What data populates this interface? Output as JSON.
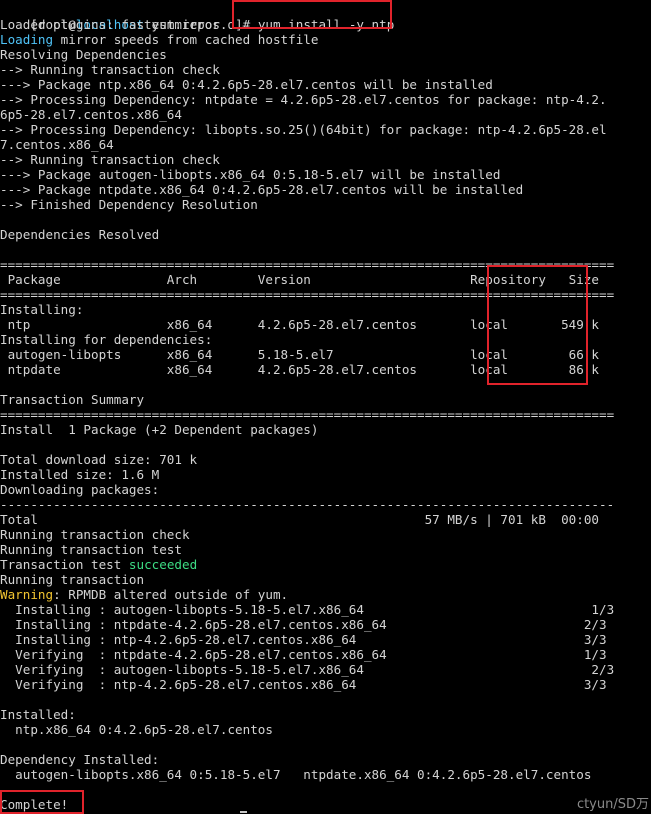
{
  "terminal": {
    "prompt": {
      "user": "[root@",
      "host": "localhost",
      "path": " yum.repos.d]# ",
      "command": "yum install -y ntp"
    },
    "lines": [
      [
        [
          "Loaded plugins: fastestmirror",
          "dim"
        ]
      ],
      [
        [
          "Loading",
          "host"
        ],
        [
          " mirror speeds from cached hostfile",
          "dim"
        ]
      ],
      [
        [
          "Resolving Dependencies",
          "dim"
        ]
      ],
      [
        [
          "--> Running transaction check",
          "dim"
        ]
      ],
      [
        [
          "---> Package ntp.x86_64 0:4.2.6p5-28.el7.centos will be installed",
          "dim"
        ]
      ],
      [
        [
          "--> Processing Dependency: ntpdate = 4.2.6p5-28.el7.centos for package: ntp-4.2.",
          "dim"
        ]
      ],
      [
        [
          "6p5-28.el7.centos.x86_64",
          "dim"
        ]
      ],
      [
        [
          "--> Processing Dependency: libopts.so.25()(64bit) for package: ntp-4.2.6p5-28.el",
          "dim"
        ]
      ],
      [
        [
          "7.centos.x86_64",
          "dim"
        ]
      ],
      [
        [
          "--> Running transaction check",
          "dim"
        ]
      ],
      [
        [
          "---> Package autogen-libopts.x86_64 0:5.18-5.el7 will be installed",
          "dim"
        ]
      ],
      [
        [
          "---> Package ntpdate.x86_64 0:4.2.6p5-28.el7.centos will be installed",
          "dim"
        ]
      ],
      [
        [
          "--> Finished Dependency Resolution",
          "dim"
        ]
      ],
      [
        [
          "",
          "dim"
        ]
      ],
      [
        [
          "Dependencies Resolved",
          "dim"
        ]
      ],
      [
        [
          "",
          "dim"
        ]
      ],
      [
        [
          "=================================================================================",
          "dim"
        ]
      ],
      [
        [
          " Package              Arch        Version                     Repository   Size",
          "dim"
        ]
      ],
      [
        [
          "=================================================================================",
          "dim"
        ]
      ],
      [
        [
          "Installing:",
          "dim"
        ]
      ],
      [
        [
          " ntp                  x86_64      4.2.6p5-28.el7.centos       local       549 k",
          "dim"
        ]
      ],
      [
        [
          "Installing for dependencies:",
          "dim"
        ]
      ],
      [
        [
          " autogen-libopts      x86_64      5.18-5.el7                  local        66 k",
          "dim"
        ]
      ],
      [
        [
          " ntpdate              x86_64      4.2.6p5-28.el7.centos       local        86 k",
          "dim"
        ]
      ],
      [
        [
          "",
          "dim"
        ]
      ],
      [
        [
          "Transaction Summary",
          "dim"
        ]
      ],
      [
        [
          "=================================================================================",
          "dim"
        ]
      ],
      [
        [
          "Install  1 Package (+2 Dependent packages)",
          "dim"
        ]
      ],
      [
        [
          "",
          "dim"
        ]
      ],
      [
        [
          "Total download size: 701 k",
          "dim"
        ]
      ],
      [
        [
          "Installed size: 1.6 M",
          "dim"
        ]
      ],
      [
        [
          "Downloading packages:",
          "dim"
        ]
      ],
      [
        [
          "---------------------------------------------------------------------------------",
          "dim"
        ]
      ],
      [
        [
          "Total                                                   57 MB/s | 701 kB  00:00",
          "dim"
        ]
      ],
      [
        [
          "Running transaction check",
          "dim"
        ]
      ],
      [
        [
          "Running transaction test",
          "dim"
        ]
      ],
      [
        [
          "Transaction test ",
          "dim"
        ],
        [
          "succeeded",
          "ok"
        ]
      ],
      [
        [
          "Running transaction",
          "dim"
        ]
      ],
      [
        [
          "Warning",
          "warn"
        ],
        [
          ": RPMDB altered outside of yum.",
          "dim"
        ]
      ],
      [
        [
          "  Installing : autogen-libopts-5.18-5.el7.x86_64                              1/3",
          "dim"
        ]
      ],
      [
        [
          "  Installing : ntpdate-4.2.6p5-28.el7.centos.x86_64                          2/3",
          "dim"
        ]
      ],
      [
        [
          "  Installing : ntp-4.2.6p5-28.el7.centos.x86_64                              3/3",
          "dim"
        ]
      ],
      [
        [
          "  Verifying  : ntpdate-4.2.6p5-28.el7.centos.x86_64                          1/3",
          "dim"
        ]
      ],
      [
        [
          "  Verifying  : autogen-libopts-5.18-5.el7.x86_64                              2/3",
          "dim"
        ]
      ],
      [
        [
          "  Verifying  : ntp-4.2.6p5-28.el7.centos.x86_64                              3/3",
          "dim"
        ]
      ],
      [
        [
          "",
          "dim"
        ]
      ],
      [
        [
          "Installed:",
          "dim"
        ]
      ],
      [
        [
          "  ntp.x86_64 0:4.2.6p5-28.el7.centos",
          "dim"
        ]
      ],
      [
        [
          "",
          "dim"
        ]
      ],
      [
        [
          "Dependency Installed:",
          "dim"
        ]
      ],
      [
        [
          "  autogen-libopts.x86_64 0:5.18-5.el7   ntpdate.x86_64 0:4.2.6p5-28.el7.centos",
          "dim"
        ]
      ],
      [
        [
          "",
          "dim"
        ]
      ],
      [
        [
          "Complete!",
          "dim"
        ]
      ]
    ]
  },
  "colors": {
    "background": "#000000",
    "text": "#d4d4d4",
    "host": "#4fc3f7",
    "success": "#3ddc84",
    "warning": "#f2c531",
    "highlight_box": "#e0232b"
  },
  "watermark": "ctyun/SD万"
}
